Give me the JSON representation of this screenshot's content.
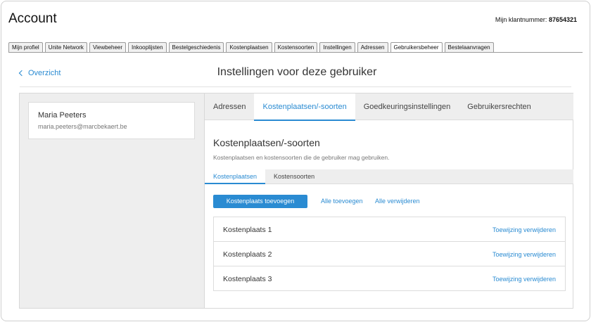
{
  "header": {
    "title": "Account",
    "customer_label": "Mijn klantnummer:",
    "customer_number": "87654321"
  },
  "tabs": [
    {
      "label": "Mijn profiel"
    },
    {
      "label": "Unite Network"
    },
    {
      "label": "Viewbeheer"
    },
    {
      "label": "Inkooplijsten"
    },
    {
      "label": "Bestelgeschiedenis"
    },
    {
      "label": "Kostenplaatsen"
    },
    {
      "label": "Kostensoorten"
    },
    {
      "label": "Instellingen"
    },
    {
      "label": "Adressen"
    },
    {
      "label": "Gebruikersbeheer",
      "active": true
    },
    {
      "label": "Bestelaanvragen"
    }
  ],
  "page": {
    "back_label": "Overzicht",
    "heading": "Instellingen voor deze gebruiker"
  },
  "user": {
    "name": "Maria Peeters",
    "email": "maria.peeters@marcbekaert.be"
  },
  "main_tabs": [
    {
      "label": "Adressen"
    },
    {
      "label": "Kostenplaatsen/-soorten",
      "active": true
    },
    {
      "label": "Goedkeuringsinstellingen"
    },
    {
      "label": "Gebruikersrechten"
    }
  ],
  "section": {
    "title": "Kostenplaatsen/-soorten",
    "description": "Kostenplaatsen en kostensoorten die de gebruiker mag gebruiken."
  },
  "sub_tabs": [
    {
      "label": "Kostenplaatsen",
      "active": true
    },
    {
      "label": "Kostensoorten"
    }
  ],
  "actions": {
    "add_label": "Kostenplaats toevoegen",
    "add_all_label": "Alle toevoegen",
    "remove_all_label": "Alle verwijderen"
  },
  "list": {
    "remove_label": "Toewijzing verwijderen",
    "items": [
      {
        "name": "Kostenplaats 1"
      },
      {
        "name": "Kostenplaats 2"
      },
      {
        "name": "Kostenplaats 3"
      }
    ]
  },
  "colors": {
    "accent": "#2a8bd2"
  }
}
